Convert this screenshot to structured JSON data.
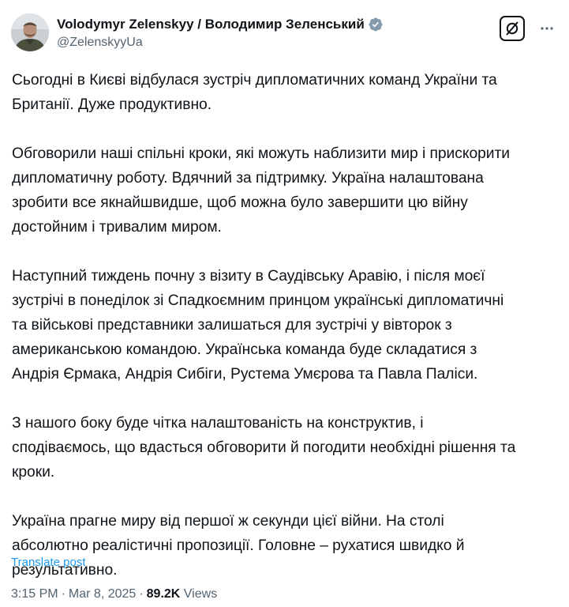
{
  "author": {
    "display_name": "Volodymyr Zelenskyy / Володимир Зеленський",
    "handle": "@ZelenskyyUa",
    "verified": true,
    "verified_badge_color": "#829aab"
  },
  "actions": {
    "grok_icon": "grok-icon",
    "more_icon": "more-horizontal-icon"
  },
  "post": {
    "paragraphs": [
      "Сьогодні в Києві відбулася зустріч дипломатичних команд України та\nБританії. Дуже продуктивно.",
      "Обговорили наші спільні кроки, які можуть наблизити мир і прискорити\nдипломатичну роботу. Вдячний за підтримку. Україна налаштована\nзробити все якнайшвидше, щоб можна було завершити цю війну\nдостойним і тривалим миром.",
      "Наступний тиждень почну з візиту в Саудівську Аравію, і після моєї\nзустрічі в понеділок зі Спадкоємним принцом українські дипломатичні\nта військові представники залишаться для зустрічі у вівторок з\nамериканською командою. Українська команда буде складатися з\nАндрія Єрмака, Андрія Сибіги, Рустема Умєрова та Павла Паліси.",
      "З нашого боку буде чітка налаштованість на конструктив, і\nсподіваємось, що вдасться обговорити й погодити необхідні рішення та\nкроки.",
      "Україна прагне миру від першої ж секунди цієї війни. На столі\nабсолютно реалістичні пропозиції. Головне – рухатися швидко й\nрезультативно."
    ],
    "translate_label": "Translate post"
  },
  "meta": {
    "time": "3:15 PM",
    "separator": "·",
    "date": "Mar 8, 2025",
    "views_count": "89.2K",
    "views_label": "Views"
  },
  "colors": {
    "text": "#0f1419",
    "secondary": "#536471",
    "link": "#1d9bf0"
  }
}
